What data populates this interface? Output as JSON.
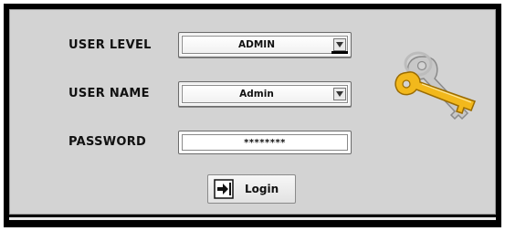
{
  "form": {
    "user_level_label": "USER LEVEL",
    "user_level_value": "ADMIN",
    "user_name_label": "USER NAME",
    "user_name_value": "Admin",
    "password_label": "PASSWORD",
    "password_value": "********",
    "login_label": "Login"
  },
  "icons": {
    "keys": "keys-icon",
    "login": "login-arrow-icon",
    "dropdown": "chevron-down-icon"
  },
  "colors": {
    "panel": "#d3d3d3",
    "frame": "#000000",
    "key_gold": "#f2b81c"
  }
}
